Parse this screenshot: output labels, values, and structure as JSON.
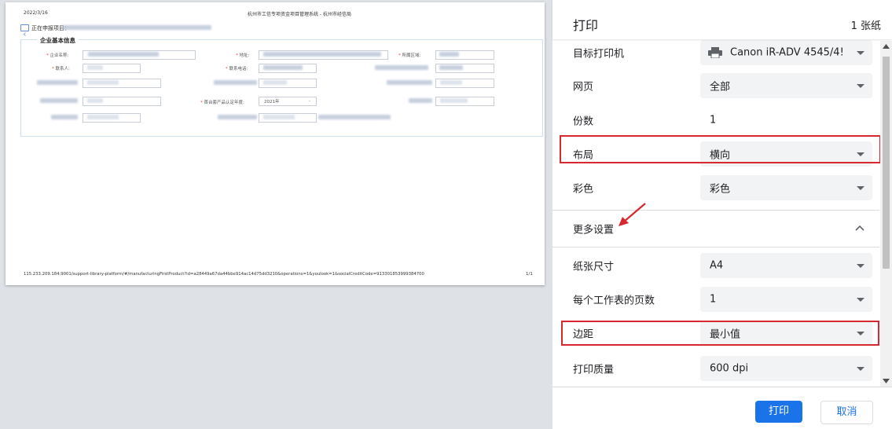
{
  "preview": {
    "date": "2022/3/16",
    "doc_title": "杭州市工信专项资金项目管理系统 - 杭州市经信局",
    "project_prefix": "正在申报项目：",
    "back_icon": "back-icon",
    "section_title": "企业基本信息",
    "labels": {
      "company_name": "企业名称:",
      "address": "地址:",
      "region": "所属区域:",
      "contact": "联系人:",
      "phone": "联系电话:",
      "first_set_year_label": "首台套产品认定年度:",
      "first_set_year_value": "2021年"
    },
    "url": "115.233.209.184:9001/support-library-platform/#/manufacturingFirstProduct?id=a28449a67da44bbe914ac14d75dd3210&operations=1&youlook=1&socialCreditCode=913301853999384700",
    "page_num": "1/1"
  },
  "panel": {
    "title": "打印",
    "sheet_count": "1 张纸",
    "destination": {
      "label": "目标打印机",
      "value": "Canon iR-ADV 4545/4!"
    },
    "pages": {
      "label": "网页",
      "value": "全部"
    },
    "copies": {
      "label": "份数",
      "value": "1"
    },
    "layout": {
      "label": "布局",
      "value": "横向"
    },
    "color": {
      "label": "彩色",
      "value": "彩色"
    },
    "more_settings": {
      "label": "更多设置"
    },
    "paper_size": {
      "label": "纸张尺寸",
      "value": "A4"
    },
    "pages_per_sheet": {
      "label": "每个工作表的页数",
      "value": "1"
    },
    "margins": {
      "label": "边距",
      "value": "最小值"
    },
    "quality": {
      "label": "打印质量",
      "value": "600 dpi"
    },
    "print_button": "打印",
    "cancel_button": "取消"
  },
  "colors": {
    "accent": "#1a73e8",
    "highlight": "#d7272f"
  }
}
